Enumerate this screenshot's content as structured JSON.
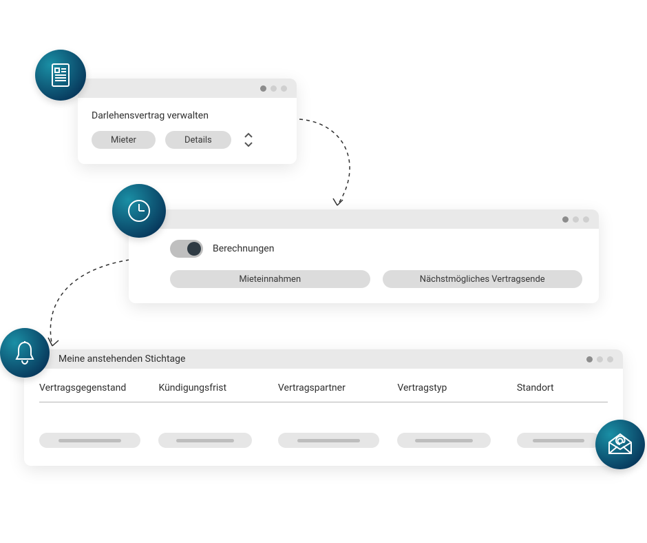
{
  "badges": {
    "document": "document-icon",
    "clock": "clock-icon",
    "bell": "bell-icon",
    "mail": "mail-icon"
  },
  "card1": {
    "title": "Darlehensvertrag verwalten",
    "pills": [
      "Mieter",
      "Details"
    ]
  },
  "card2": {
    "toggle_label": "Berechnungen",
    "pills": [
      "Mieteinnahmen",
      "Nächstmögliches Vertragsende"
    ]
  },
  "card3": {
    "title": "Meine anstehenden Stichtage",
    "columns": [
      "Vertragsgegenstand",
      "Kündigungsfrist",
      "Vertragspartner",
      "Vertragstyp",
      "Standort"
    ]
  }
}
